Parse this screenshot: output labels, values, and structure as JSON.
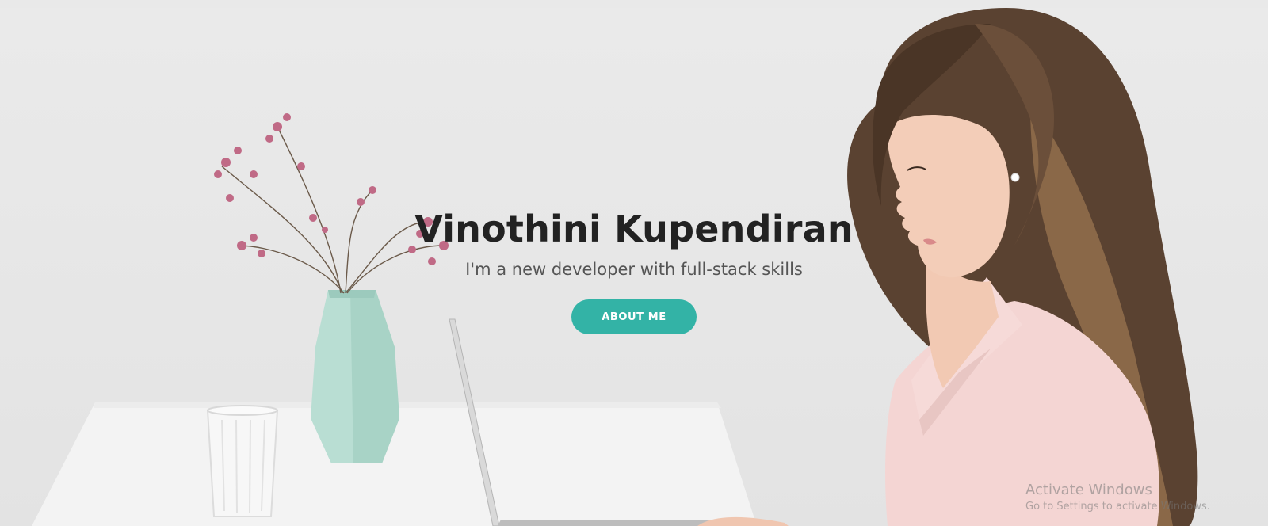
{
  "hero": {
    "title": "Vinothini Kupendiran",
    "subtitle": "I'm a new developer with full-stack skills",
    "cta_label": "ABOUT ME"
  },
  "watermark": {
    "title": "Activate Windows",
    "subtitle": "Go to Settings to activate Windows."
  },
  "colors": {
    "accent": "#33b3a6",
    "title": "#222222",
    "subtitle": "#555555",
    "background": "#e8e8e8"
  }
}
